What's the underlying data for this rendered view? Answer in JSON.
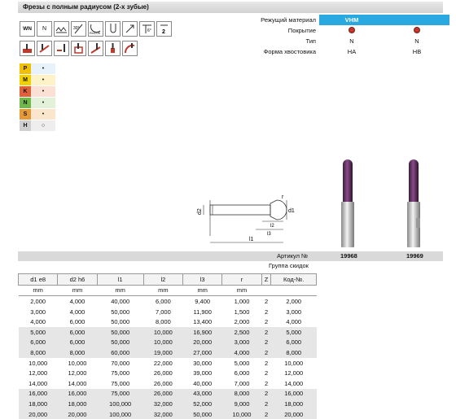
{
  "title": "Фрезы с полным радиусом (2-х зубые)",
  "icons_row1": [
    "WN",
    "N",
    "≈",
    "30°",
    "R±0.05",
    "",
    "",
    "6°",
    "2"
  ],
  "properties": [
    {
      "label": "Режущий материал",
      "values": [
        "VHM",
        ""
      ]
    },
    {
      "label": "Покрытие",
      "values": [
        "",
        ""
      ]
    },
    {
      "label": "Тип",
      "values": [
        "N",
        "N"
      ]
    },
    {
      "label": "Форма хвостовика",
      "values": [
        "HA",
        "HB"
      ]
    }
  ],
  "materials": [
    {
      "code": "P",
      "color": "#f0c000",
      "mark": "•",
      "bg": "#e8f2fb"
    },
    {
      "code": "M",
      "color": "#f0d000",
      "mark": "•",
      "bg": "#fdf2c8"
    },
    {
      "code": "K",
      "color": "#e0603a",
      "mark": "•",
      "bg": "#fbe0d5"
    },
    {
      "code": "N",
      "color": "#70b84a",
      "mark": "•",
      "bg": "#e3f0da"
    },
    {
      "code": "S",
      "color": "#e59a3a",
      "mark": "•",
      "bg": "#fbe5cd"
    },
    {
      "code": "H",
      "color": "#cfcfcf",
      "mark": "○",
      "bg": "#eeeeee"
    }
  ],
  "drawing_labels": {
    "d2": "d2",
    "d1": "d1",
    "r": "r",
    "l2": "l2",
    "l3": "l3",
    "l1": "l1"
  },
  "article_label": "Артикул №",
  "articles": [
    "19968",
    "19969"
  ],
  "group_label": "Группа скидок",
  "headers": [
    "d1 e8",
    "d2 h6",
    "l1",
    "l2",
    "l3",
    "r",
    "Z",
    "Код-№."
  ],
  "units": [
    "mm",
    "mm",
    "mm",
    "mm",
    "mm",
    "mm",
    "",
    ""
  ],
  "rows": [
    [
      "2,000",
      "4,000",
      "40,000",
      "6,000",
      "9,400",
      "1,000",
      "2",
      "2,000"
    ],
    [
      "3,000",
      "4,000",
      "50,000",
      "7,000",
      "11,900",
      "1,500",
      "2",
      "3,000"
    ],
    [
      "4,000",
      "6,000",
      "50,000",
      "8,000",
      "13,400",
      "2,000",
      "2",
      "4,000"
    ],
    [
      "5,000",
      "6,000",
      "50,000",
      "10,000",
      "16,900",
      "2,500",
      "2",
      "5,000"
    ],
    [
      "6,000",
      "6,000",
      "50,000",
      "10,000",
      "20,000",
      "3,000",
      "2",
      "6,000"
    ],
    [
      "8,000",
      "8,000",
      "60,000",
      "19,000",
      "27,000",
      "4,000",
      "2",
      "8,000"
    ],
    [
      "10,000",
      "10,000",
      "70,000",
      "22,000",
      "30,000",
      "5,000",
      "2",
      "10,000"
    ],
    [
      "12,000",
      "12,000",
      "75,000",
      "26,000",
      "39,000",
      "6,000",
      "2",
      "12,000"
    ],
    [
      "14,000",
      "14,000",
      "75,000",
      "26,000",
      "40,000",
      "7,000",
      "2",
      "14,000"
    ],
    [
      "16,000",
      "16,000",
      "75,000",
      "26,000",
      "43,000",
      "8,000",
      "2",
      "16,000"
    ],
    [
      "18,000",
      "18,000",
      "100,000",
      "32,000",
      "52,000",
      "9,000",
      "2",
      "18,000"
    ],
    [
      "20,000",
      "20,000",
      "100,000",
      "32,000",
      "50,000",
      "10,000",
      "2",
      "20,000"
    ]
  ]
}
